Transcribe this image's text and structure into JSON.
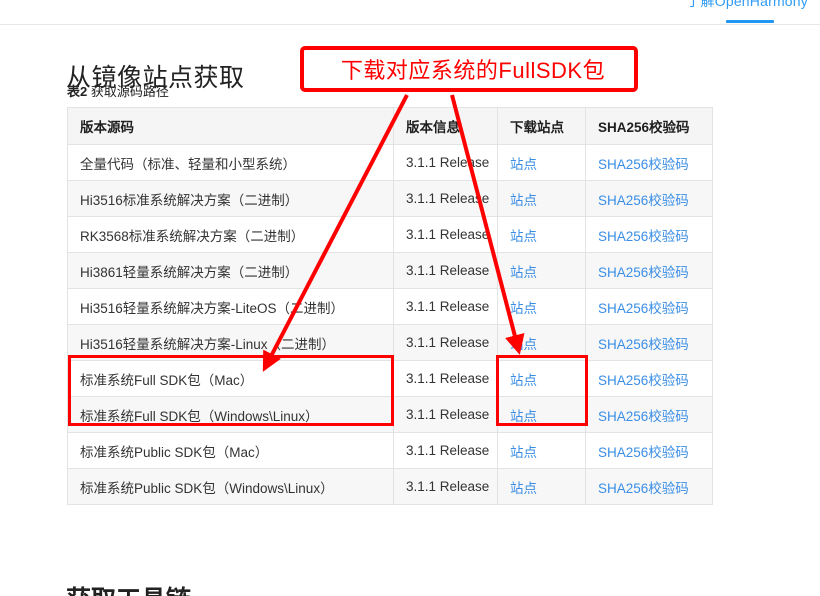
{
  "top_nav": {
    "link_label": "了解OpenHarmony",
    "accent_color": "#2296f3"
  },
  "page": {
    "section_heading": "从镜像站点获取",
    "caption_number": "表2",
    "caption_text": " 获取源码路径",
    "next_section_heading": "获取工具链"
  },
  "table": {
    "headers": {
      "source": "版本源码",
      "version": "版本信息",
      "site": "下载站点",
      "sha": "SHA256校验码"
    },
    "rows": [
      {
        "source": "全量代码（标准、轻量和小型系统）",
        "version": "3.1.1 Release",
        "site": "站点",
        "sha": "SHA256校验码"
      },
      {
        "source": "Hi3516标准系统解决方案（二进制）",
        "version": "3.1.1 Release",
        "site": "站点",
        "sha": "SHA256校验码"
      },
      {
        "source": "RK3568标准系统解决方案（二进制）",
        "version": "3.1.1 Release",
        "site": "站点",
        "sha": "SHA256校验码"
      },
      {
        "source": "Hi3861轻量系统解决方案（二进制）",
        "version": "3.1.1 Release",
        "site": "站点",
        "sha": "SHA256校验码"
      },
      {
        "source": "Hi3516轻量系统解决方案-LiteOS（二进制）",
        "version": "3.1.1 Release",
        "site": "站点",
        "sha": "SHA256校验码"
      },
      {
        "source": "Hi3516轻量系统解决方案-Linux（二进制）",
        "version": "3.1.1 Release",
        "site": "站点",
        "sha": "SHA256校验码"
      },
      {
        "source": "标准系统Full SDK包（Mac）",
        "version": "3.1.1 Release",
        "site": "站点",
        "sha": "SHA256校验码"
      },
      {
        "source": "标准系统Full SDK包（Windows\\Linux）",
        "version": "3.1.1 Release",
        "site": "站点",
        "sha": "SHA256校验码"
      },
      {
        "source": "标准系统Public SDK包（Mac）",
        "version": "3.1.1 Release",
        "site": "站点",
        "sha": "SHA256校验码"
      },
      {
        "source": "标准系统Public SDK包（Windows\\Linux）",
        "version": "3.1.1 Release",
        "site": "站点",
        "sha": "SHA256校验码"
      }
    ]
  },
  "annotation": {
    "callout_text": "下载对应系统的FullSDK包",
    "color": "#fe0000"
  }
}
